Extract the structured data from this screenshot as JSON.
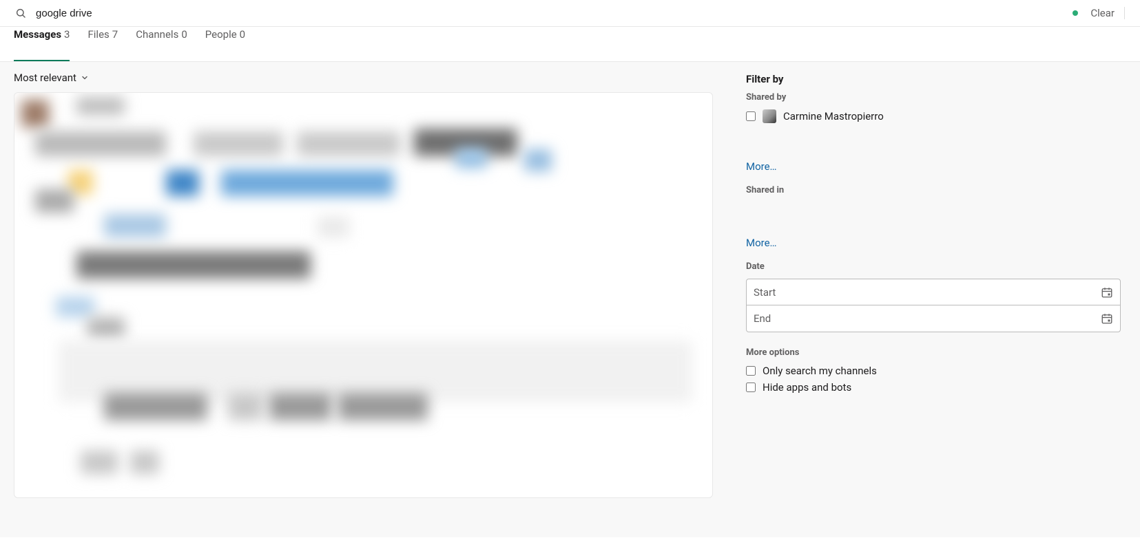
{
  "search": {
    "value": "google drive",
    "clear_label": "Clear"
  },
  "tabs": {
    "messages": {
      "label": "Messages",
      "count": "3"
    },
    "files": {
      "label": "Files",
      "count": "7"
    },
    "channels": {
      "label": "Channels",
      "count": "0"
    },
    "people": {
      "label": "People",
      "count": "0"
    }
  },
  "sort": {
    "label": "Most relevant"
  },
  "filters": {
    "heading": "Filter by",
    "shared_by_label": "Shared by",
    "person_name": "Carmine Mastropierro",
    "more_label": "More…",
    "shared_in_label": "Shared in",
    "date_label": "Date",
    "date_start": "Start",
    "date_end": "End",
    "more_options_label": "More options",
    "opt_only_my_channels": "Only search my channels",
    "opt_hide_bots": "Hide apps and bots"
  }
}
